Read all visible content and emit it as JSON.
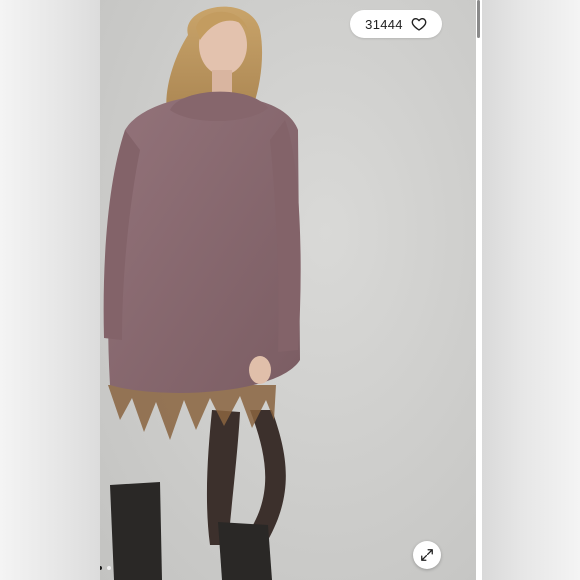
{
  "listing": {
    "like_count": "31444",
    "heart_icon": "heart-outline-icon",
    "expand_icon": "expand-arrows-icon"
  },
  "carousel": {
    "total_images": 2,
    "active_index": 0
  },
  "colors": {
    "sweater": "#8a6a70",
    "background": "#cfcfcd",
    "boots": "#2a2826"
  }
}
